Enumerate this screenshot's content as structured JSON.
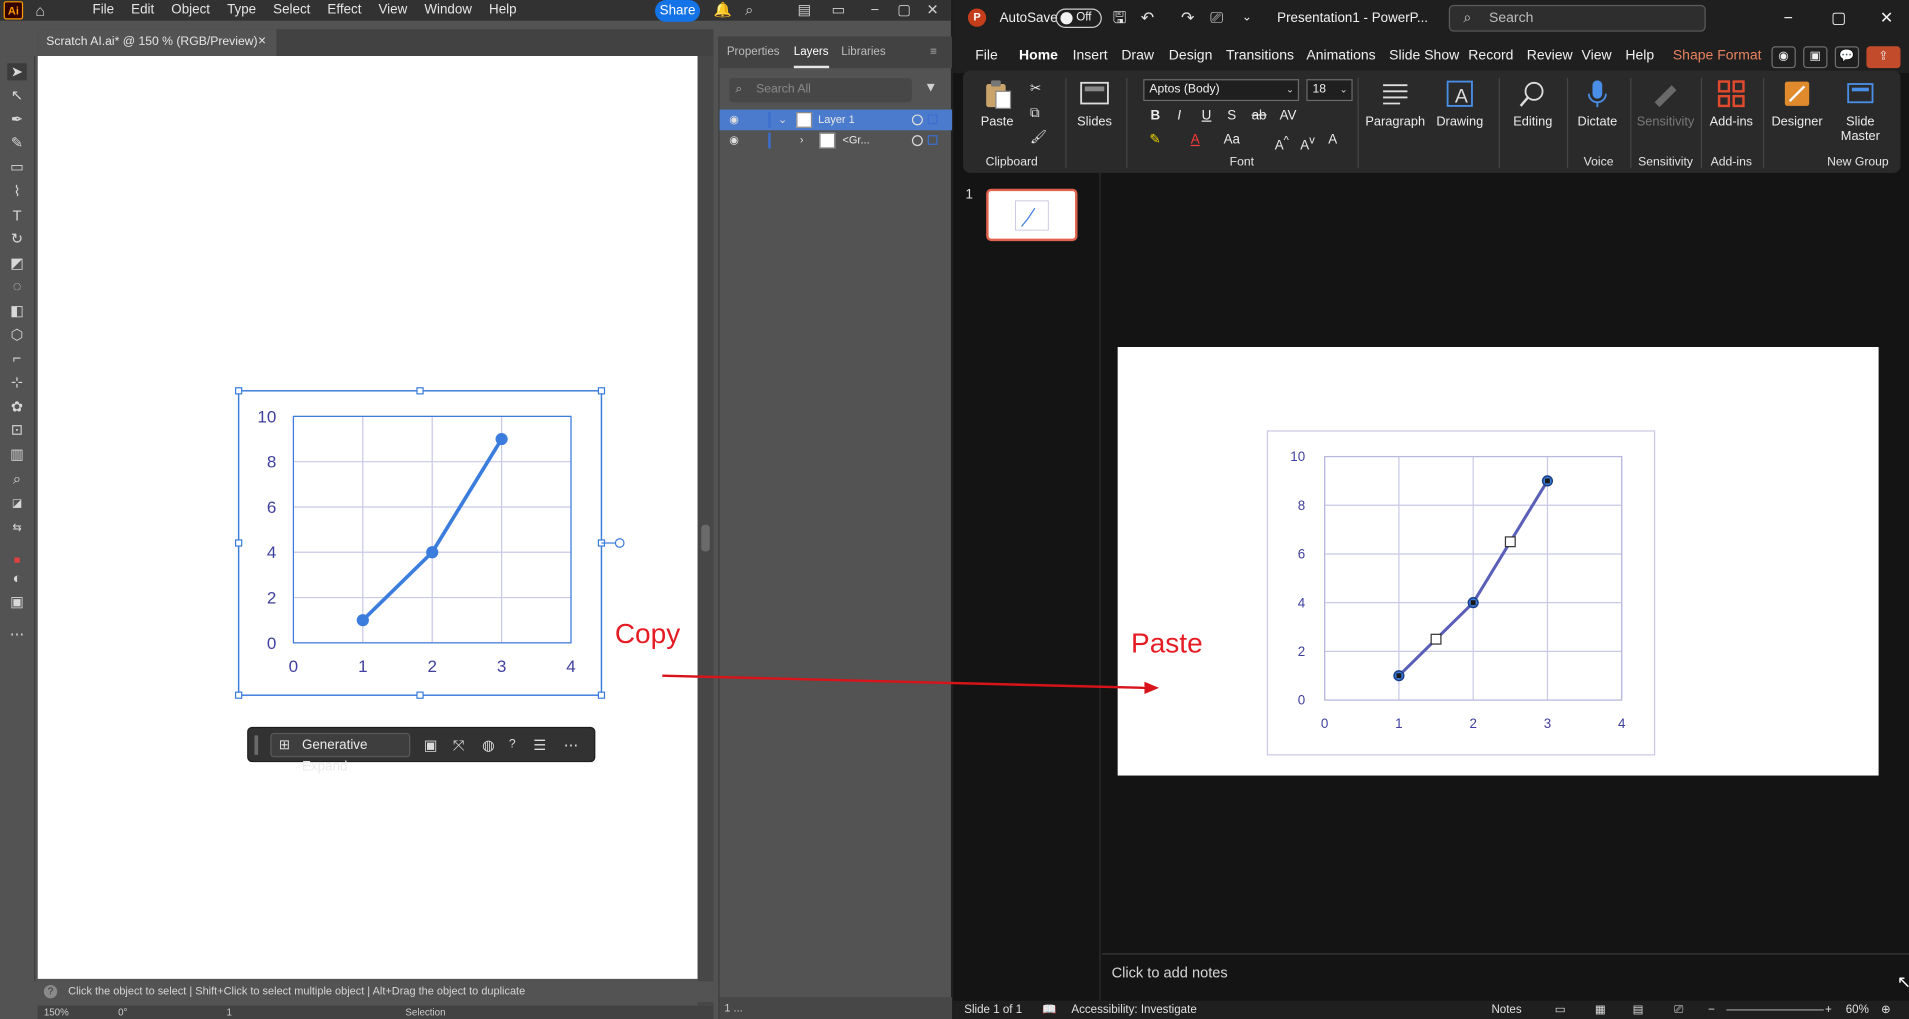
{
  "illustrator": {
    "logo": "Ai",
    "menus": [
      "File",
      "Edit",
      "Object",
      "Type",
      "Select",
      "Effect",
      "View",
      "Window",
      "Help"
    ],
    "share_label": "Share",
    "doc_tab": "Scratch AI.ai* @ 150 % (RGB/Preview)",
    "panel_tabs": [
      "Properties",
      "Layers",
      "Libraries"
    ],
    "layers_search_placeholder": "Search All",
    "layers": [
      {
        "name": "Layer 1"
      },
      {
        "name": "<Gr..."
      }
    ],
    "context_bar": {
      "generative_expand": "Generative Expand"
    },
    "status_text": "Click the object to select  |  Shift+Click to select multiple object  |  Alt+Drag the object to duplicate",
    "bottom": {
      "zoom": "150%",
      "rotation": "0°",
      "artboard": "1",
      "tool": "Selection",
      "layers_count": "1 ..."
    }
  },
  "annotations": {
    "copy": "Copy",
    "paste": "Paste"
  },
  "powerpoint": {
    "logo": "P",
    "autosave_label": "AutoSave",
    "autosave_state": "Off",
    "doc_title": "Presentation1  -  PowerP...",
    "search_placeholder": "Search",
    "tabs": [
      "File",
      "Home",
      "Insert",
      "Draw",
      "Design",
      "Transitions",
      "Animations",
      "Slide Show",
      "Record",
      "Review",
      "View",
      "Help",
      "Shape Format"
    ],
    "ribbon": {
      "paste": "Paste",
      "clipboard": "Clipboard",
      "slides": "Slides",
      "font_name": "Aptos (Body)",
      "font_size": "18",
      "font": "Font",
      "paragraph": "Paragraph",
      "drawing": "Drawing",
      "editing": "Editing",
      "dictate": "Dictate",
      "voice": "Voice",
      "sensitivity_btn": "Sensitivity",
      "sensitivity": "Sensitivity",
      "addins_btn": "Add-ins",
      "addins": "Add-ins",
      "designer": "Designer",
      "slide_master": "Slide Master",
      "new_group": "New Group"
    },
    "slide_number": "1",
    "notes_placeholder": "Click to add notes",
    "status": {
      "slide_of": "Slide 1 of 1",
      "accessibility": "Accessibility: Investigate",
      "notes": "Notes",
      "zoom": "60%"
    }
  },
  "chart_data": [
    {
      "type": "line",
      "x": [
        1,
        2,
        3
      ],
      "y": [
        1,
        4,
        9
      ],
      "xlim": [
        0,
        4
      ],
      "ylim": [
        0,
        10
      ],
      "xticks": [
        0,
        1,
        2,
        3,
        4
      ],
      "yticks": [
        0,
        2,
        4,
        6,
        8,
        10
      ],
      "grid": true,
      "color": "#3b7ddd"
    },
    {
      "type": "line",
      "x": [
        1,
        2,
        3
      ],
      "y": [
        1,
        4,
        9
      ],
      "xlim": [
        0,
        4
      ],
      "ylim": [
        0,
        10
      ],
      "xticks": [
        0,
        1,
        2,
        3,
        4
      ],
      "yticks": [
        0,
        2,
        4,
        6,
        8,
        10
      ],
      "grid": true,
      "color": "#3b7ddd"
    }
  ],
  "colors": {
    "accent_blue": "#1473e6",
    "annotation_red": "#e51c23",
    "pp_accent": "#e8614b",
    "chart_text": "#3f3f9f",
    "grid": "#c8c8e8"
  }
}
